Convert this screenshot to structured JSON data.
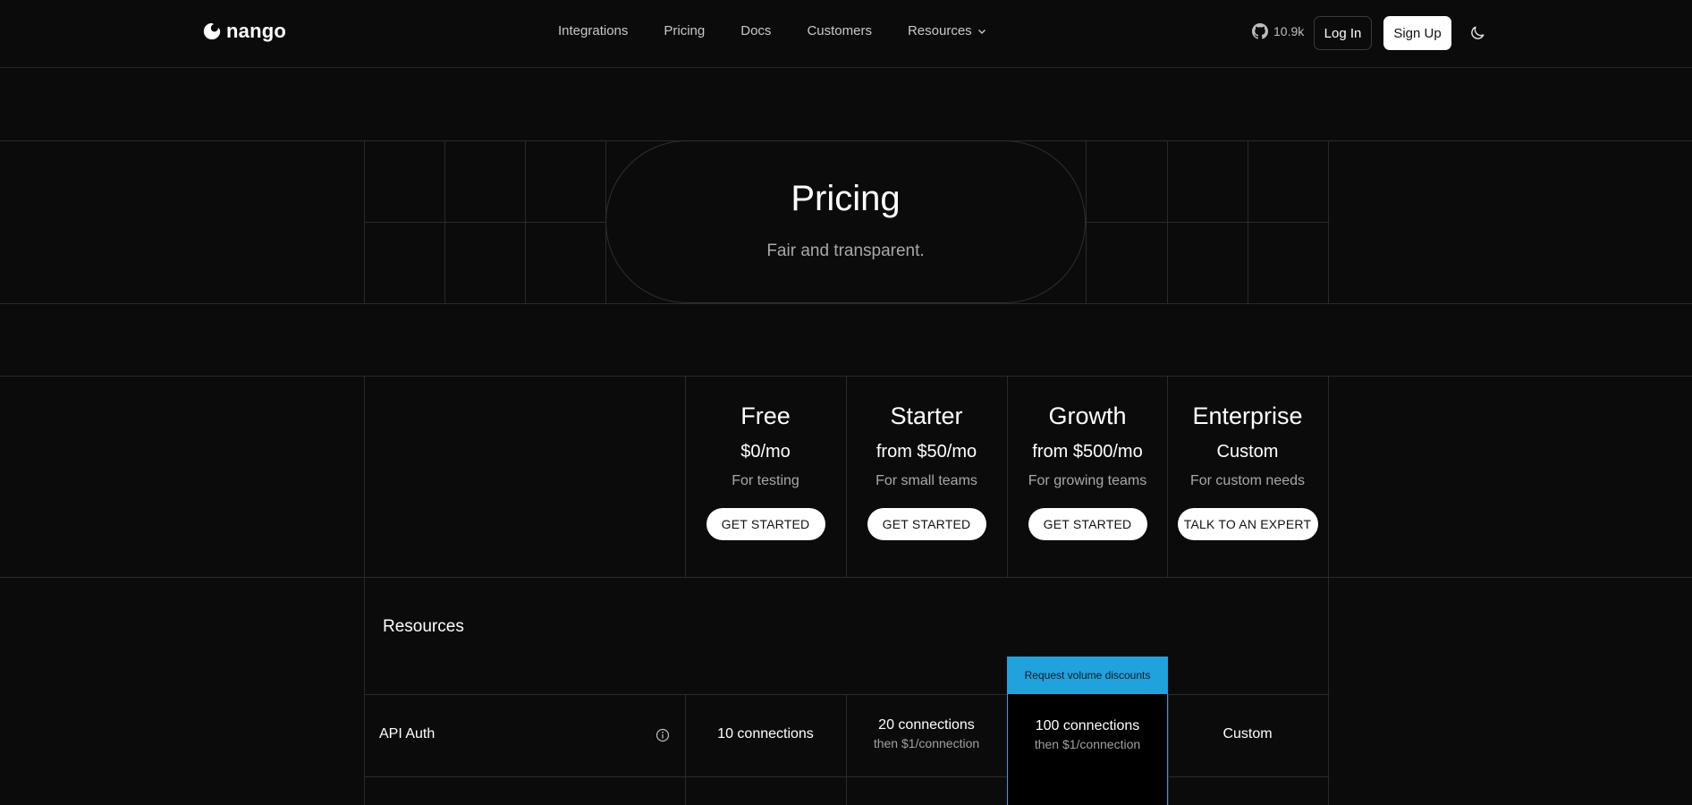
{
  "nav": {
    "logo_text": "nango",
    "links": [
      {
        "label": "Integrations"
      },
      {
        "label": "Pricing"
      },
      {
        "label": "Docs"
      },
      {
        "label": "Customers"
      },
      {
        "label": "Resources"
      }
    ],
    "github_stars": "10.9k",
    "login_label": "Log In",
    "signup_label": "Sign Up"
  },
  "hero": {
    "title": "Pricing",
    "subtitle": "Fair and transparent."
  },
  "plans": [
    {
      "name": "Free",
      "price": "$0/mo",
      "description": "For testing",
      "button": "GET STARTED"
    },
    {
      "name": "Starter",
      "price": "from $50/mo",
      "description": "For small teams",
      "button": "GET STARTED"
    },
    {
      "name": "Growth",
      "price": "from $500/mo",
      "description": "For growing teams",
      "button": "GET STARTED"
    },
    {
      "name": "Enterprise",
      "price": "Custom",
      "description": "For custom needs",
      "button": "TALK TO AN EXPERT"
    }
  ],
  "resources": {
    "section_title": "Resources",
    "volume_badge": "Request volume discounts",
    "rows": [
      {
        "label": "API Auth",
        "free": {
          "main": "10 connections"
        },
        "starter": {
          "main": "20 connections",
          "sub": "then $1/connection"
        },
        "growth": {
          "main": "100 connections",
          "sub": "then $1/connection"
        },
        "enterprise": {
          "main": "Custom"
        }
      }
    ]
  },
  "colors": {
    "background": "#0b0b0b",
    "accent": "#20a2dc",
    "grid_line": "#2a2a2a"
  }
}
